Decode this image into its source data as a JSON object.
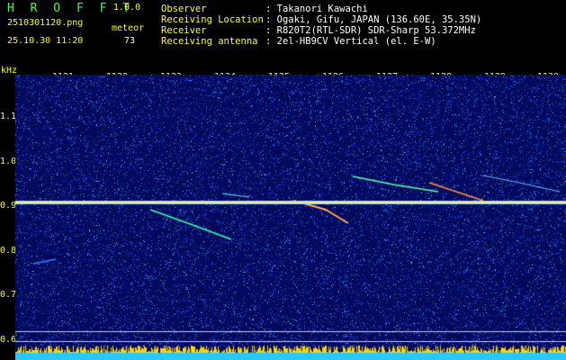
{
  "header": {
    "app_title": "H R O F F T",
    "app_version": "1.0.0",
    "filename": "2510301120.png",
    "timestamp": "25.10.30 11:20",
    "meteor_label": "meteor",
    "meteor_count": "73"
  },
  "info": [
    {
      "key": "Observer",
      "value": ": Takanori Kawachi"
    },
    {
      "key": "Receiving Location",
      "value": ": Ogaki, Gifu, JAPAN (136.60E, 35.35N)"
    },
    {
      "key": "Receiver",
      "value": ": R820T2(RTL-SDR) SDR-Sharp 53.372MHz"
    },
    {
      "key": "Receiving antenna",
      "value": ": 2el-HB9CV Vertical (el. E-W)"
    }
  ],
  "axis": {
    "y_unit": "kHz",
    "y_ticks": [
      "1.1",
      "1.0",
      "0.9",
      "0.8",
      "0.7",
      "0.6"
    ],
    "x_ticks": [
      "1121",
      "1122",
      "1123",
      "1124",
      "1125",
      "1126",
      "1127",
      "1128",
      "1129",
      "1130"
    ]
  },
  "colors": {
    "title": "#3cff3c",
    "label": "#ffff00",
    "value": "#ffffff",
    "noise": "#0b2fa0",
    "carrier": "#ffe880",
    "baseline": "#00ffff"
  }
}
